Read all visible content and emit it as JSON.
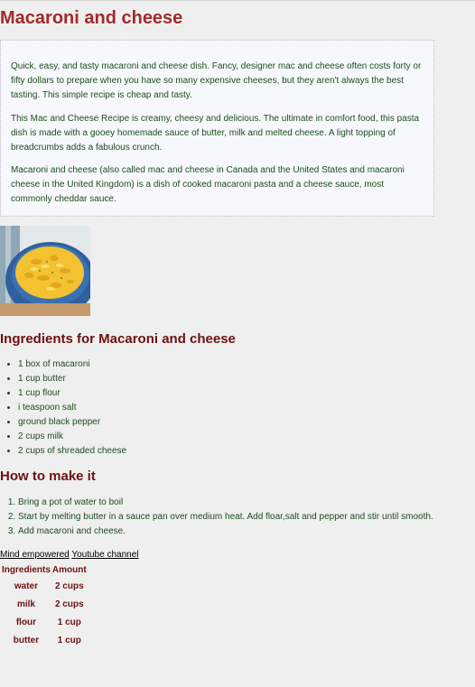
{
  "title": "Macaroni and cheese",
  "intro": {
    "paragraphs": [
      "Quick, easy, and tasty macaroni and cheese dish. Fancy, designer mac and cheese often costs forty or fifty dollars to prepare when you have so many expensive cheeses, but they aren't always the best tasting. This simple recipe is cheap and tasty.",
      "This Mac and Cheese Recipe is creamy, cheesy and delicious. The ultimate in comfort food, this pasta dish is made with a gooey homemade sauce of butter, milk and melted cheese. A light topping of breadcrumbs adds a fabulous crunch.",
      "Macaroni and cheese (also called mac and cheese in Canada and the United States and macaroni cheese in the United Kingdom) is a dish of cooked macaroni pasta and a cheese sauce, most commonly cheddar sauce."
    ]
  },
  "image": {
    "alt": "macaroni and cheese in a blue pot"
  },
  "ingredients_heading": "Ingredients for Macaroni and cheese",
  "ingredients": [
    "1 box of macaroni",
    "1 cup butter",
    "1 cup flour",
    "i teaspoon salt",
    "ground black pepper",
    "2 cups milk",
    "2 cups of shreaded cheese"
  ],
  "how_heading": "How to make it",
  "steps": [
    "Bring a pot of water to boil",
    "Start by melting butter in a sauce pan over medium heat. Add floar,salt and pepper and stir until smooth.",
    "Add macaroni and cheese."
  ],
  "links": {
    "first": "Mind empowered",
    "second": "Youtube channel"
  },
  "amount_table": {
    "headers": [
      "Ingredients",
      "Amount"
    ],
    "rows": [
      [
        "water",
        "2 cups"
      ],
      [
        "milk",
        "2 cups"
      ],
      [
        "flour",
        "1 cup"
      ],
      [
        "butter",
        "1 cup"
      ]
    ]
  }
}
